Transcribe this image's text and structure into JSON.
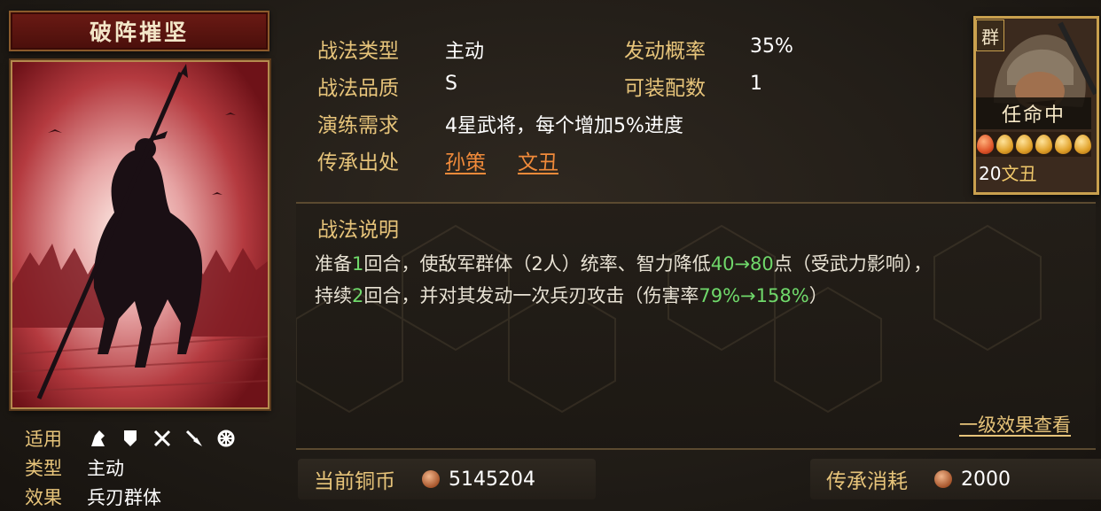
{
  "tactic": {
    "name": "破阵摧坚",
    "meta": {
      "applicable_label": "适用",
      "type_label": "类型",
      "type_value": "主动",
      "effect_label": "效果",
      "effect_value": "兵刃群体",
      "weapon_icons": [
        "cavalry-icon",
        "shield-icon",
        "bow-icon",
        "spear-icon",
        "siege-icon"
      ]
    }
  },
  "info": {
    "type_key": "战法类型",
    "type_value": "主动",
    "rate_key": "发动概率",
    "rate_value": "35%",
    "quality_key": "战法品质",
    "quality_value": "S",
    "slots_key": "可装配数",
    "slots_value": "1",
    "drill_key": "演练需求",
    "drill_value": "4星武将，每个增加5%进度",
    "source_key": "传承出处",
    "source_heroes": [
      "孙策",
      "文丑"
    ]
  },
  "description": {
    "title": "战法说明",
    "line1": {
      "p1": "准备",
      "n1": "1",
      "p2": "回合，使敌军群体（2人）统率、智力降低",
      "n2": "40→80",
      "p3": "点（受武力影响），"
    },
    "line2": {
      "p1": "持续",
      "n1": "2",
      "p2": "回合，并对其发动一次兵刃攻击（伤害率",
      "n2": "79%→158%",
      "p3": "）"
    },
    "effects_link": "一级效果查看"
  },
  "footer": {
    "coins_label": "当前铜币",
    "coins_value": "5145204",
    "cost_label": "传承消耗",
    "cost_value": "2000"
  },
  "hero": {
    "faction": "群",
    "status": "任命中",
    "level": "20",
    "name": "文丑",
    "beads": [
      "red",
      "gold",
      "gold",
      "gold",
      "gold",
      "gold"
    ]
  }
}
